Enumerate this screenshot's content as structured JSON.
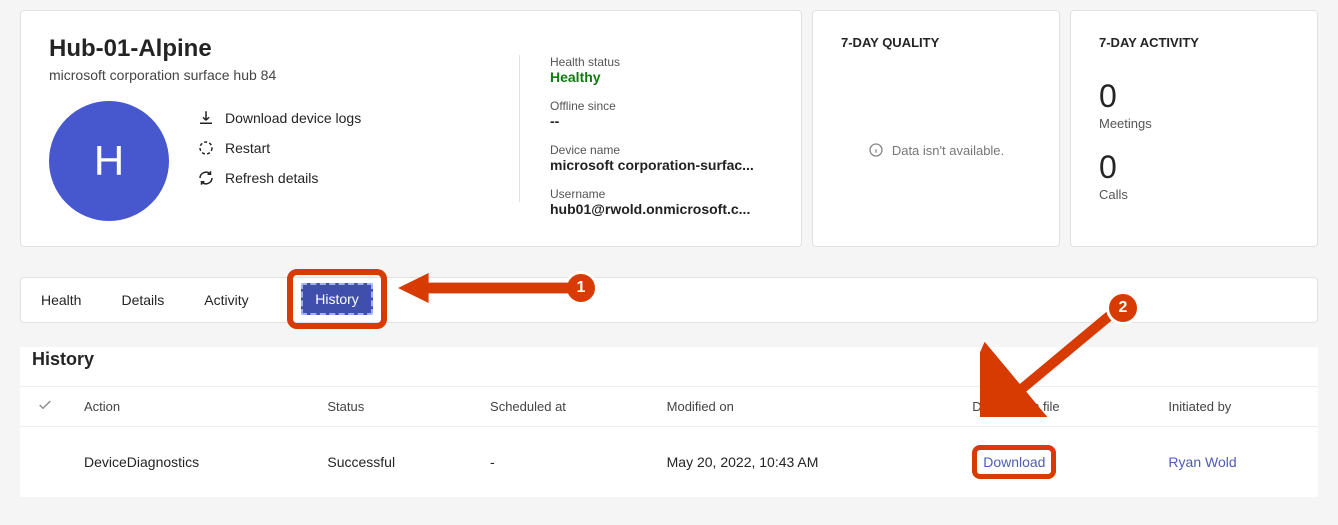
{
  "device": {
    "title": "Hub-01-Alpine",
    "subtitle": "microsoft corporation surface hub 84",
    "avatar_letter": "H"
  },
  "actions": {
    "download_logs": "Download device logs",
    "restart": "Restart",
    "refresh": "Refresh details"
  },
  "fields": {
    "health_label": "Health status",
    "health_value": "Healthy",
    "offline_label": "Offline since",
    "offline_value": "--",
    "devicename_label": "Device name",
    "devicename_value": "microsoft corporation-surfac...",
    "username_label": "Username",
    "username_value": "hub01@rwold.onmicrosoft.c..."
  },
  "quality": {
    "header": "7-DAY QUALITY",
    "no_data": "Data isn't available."
  },
  "activity": {
    "header": "7-DAY ACTIVITY",
    "meetings_count": "0",
    "meetings_label": "Meetings",
    "calls_count": "0",
    "calls_label": "Calls"
  },
  "tabs": {
    "health": "Health",
    "details": "Details",
    "activity": "Activity",
    "history": "History"
  },
  "callouts": {
    "one": "1",
    "two": "2"
  },
  "history": {
    "section_title": "History",
    "headers": {
      "action": "Action",
      "status": "Status",
      "scheduled": "Scheduled at",
      "modified": "Modified on",
      "diagnostics": "Diagnostics file",
      "initiated": "Initiated by"
    },
    "rows": [
      {
        "action": "DeviceDiagnostics",
        "status": "Successful",
        "scheduled": "-",
        "modified": "May 20, 2022, 10:43 AM",
        "diagnostics": "Download",
        "initiated": "Ryan Wold"
      }
    ]
  }
}
